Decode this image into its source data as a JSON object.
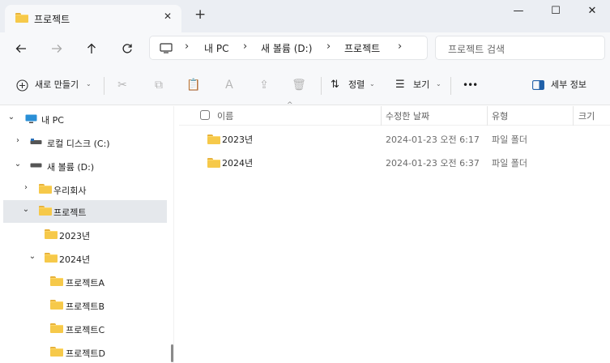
{
  "tab": {
    "title": "프로젝트",
    "close": "✕",
    "new": "+"
  },
  "window_controls": {
    "minimize": "—",
    "maximize": "☐",
    "close": "✕"
  },
  "address": {
    "segments": [
      "내 PC",
      "새 볼륨 (D:)",
      "프로젝트"
    ],
    "separator": "›",
    "search_placeholder": "프로젝트 검색"
  },
  "commands": {
    "new": "새로 만들기",
    "sort": "정렬",
    "view": "보기",
    "more": "•••",
    "details": "세부 정보"
  },
  "nav": {
    "items": [
      {
        "label": "내 PC",
        "chevron": "⌄",
        "icon": "monitor-icon"
      },
      {
        "label": "로컬 디스크 (C:)",
        "chevron": "›",
        "icon": "drive-icon"
      },
      {
        "label": "새 볼륨 (D:)",
        "chevron": "⌄",
        "icon": "drive-icon"
      },
      {
        "label": "우리회사",
        "chevron": "›",
        "icon": "folder-icon"
      },
      {
        "label": "프로젝트",
        "chevron": "⌄",
        "icon": "folder-icon"
      },
      {
        "label": "2023년",
        "chevron": "",
        "icon": "folder-icon"
      },
      {
        "label": "2024년",
        "chevron": "⌄",
        "icon": "folder-icon"
      },
      {
        "label": "프로젝트A",
        "chevron": "",
        "icon": "folder-icon"
      },
      {
        "label": "프로젝트B",
        "chevron": "",
        "icon": "folder-icon"
      },
      {
        "label": "프로젝트C",
        "chevron": "",
        "icon": "folder-icon"
      },
      {
        "label": "프로젝트D",
        "chevron": "",
        "icon": "folder-icon"
      }
    ]
  },
  "columns": {
    "name": "이름",
    "modified": "수정한 날짜",
    "type": "유형",
    "size": "크기"
  },
  "files": [
    {
      "name": "2023년",
      "modified": "2024-01-23 오전 6:17",
      "type": "파일 폴더"
    },
    {
      "name": "2024년",
      "modified": "2024-01-23 오전 6:37",
      "type": "파일 폴더"
    }
  ]
}
